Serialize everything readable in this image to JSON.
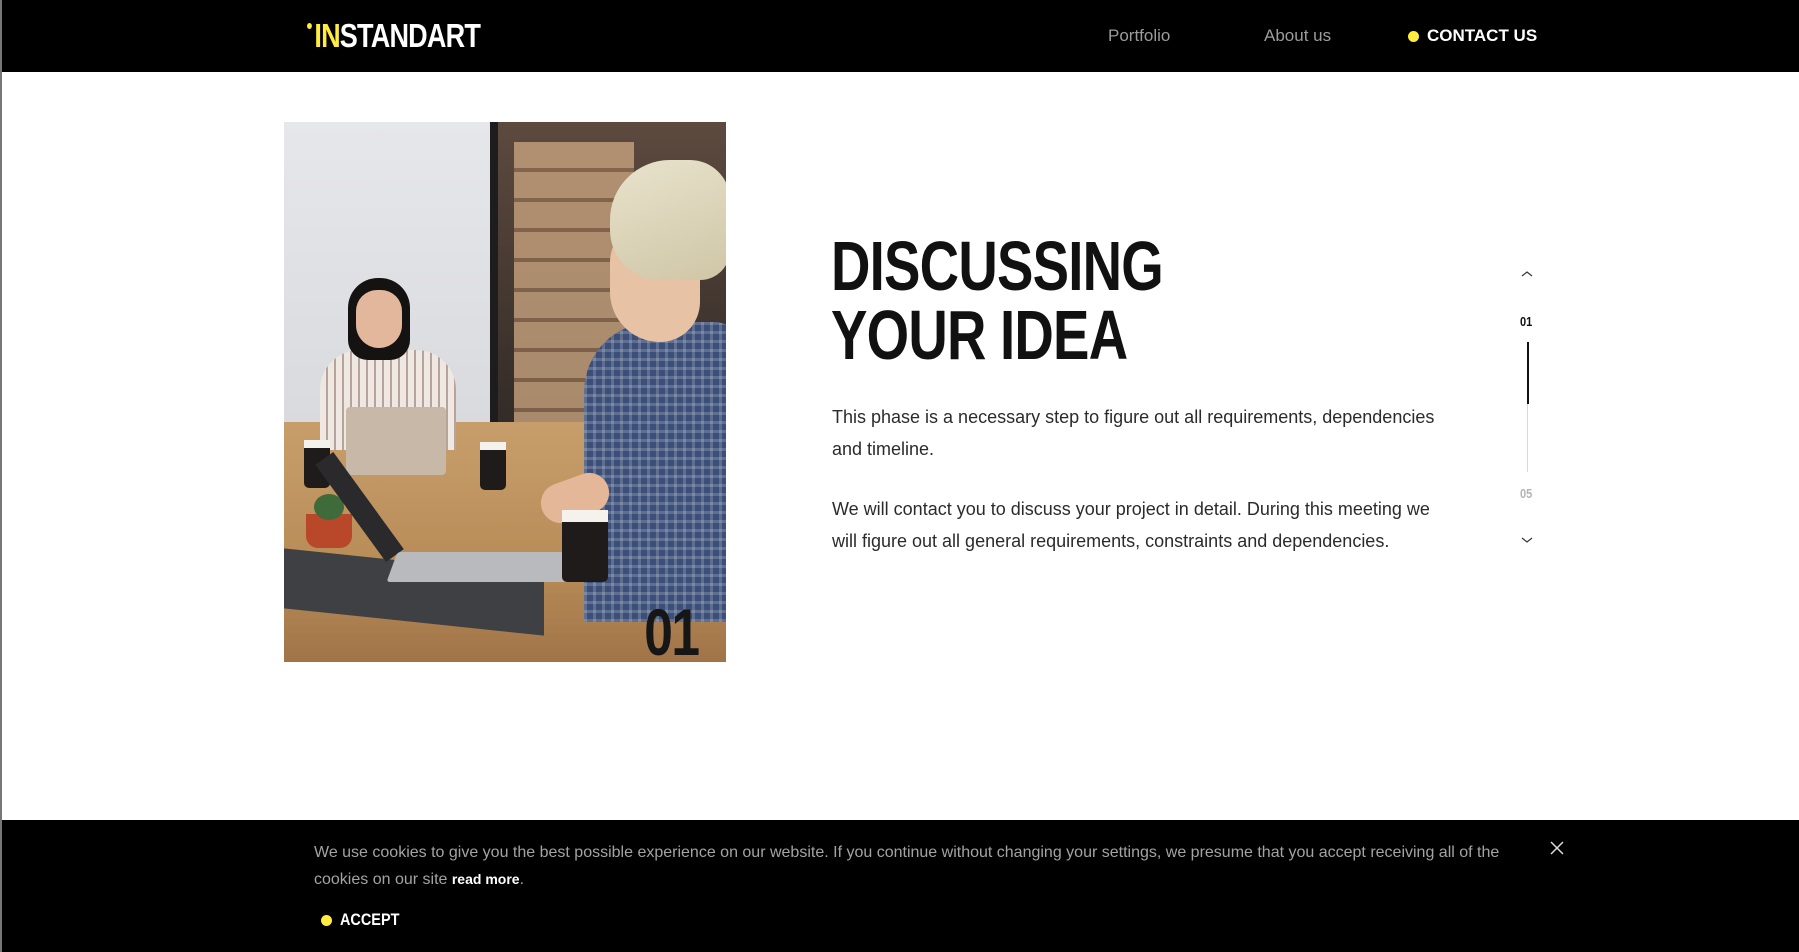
{
  "header": {
    "logo_prefix": "IN",
    "logo_rest": "STANDART",
    "nav": {
      "portfolio": "Portfolio",
      "about": "About us",
      "contact": "CONTACT US"
    }
  },
  "step": {
    "number": "01",
    "title_line1": "DISCUSSING",
    "title_line2": "YOUR IDEA",
    "paragraph1": "This phase is a necessary step to figure out all requirements, dependencies and timeline.",
    "paragraph2": "We will contact you to discuss your project in detail. During this meeting we will figure out all general requirements, constraints and dependencies."
  },
  "pager": {
    "current": "01",
    "total": "05",
    "progress": 0.2
  },
  "cookie": {
    "text": "We use cookies to give you the best possible experience on our website. If you continue without changing your settings, we presume that you accept receiving all of the cookies on our site ",
    "link": "read more",
    "period": ".",
    "accept": "ACCEPT"
  },
  "colors": {
    "accent": "#ffec3d",
    "header_bg": "#000000"
  }
}
